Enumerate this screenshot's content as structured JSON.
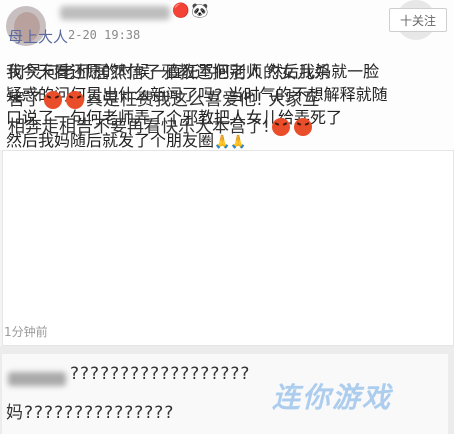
{
  "post": {
    "badges": "🔴🐼",
    "timestamp": "2-20 19:38",
    "follow_label": "十关注",
    "lines": [
      "我今天看还愿的时候一直狂骂何老师 然后我妈就一脸",
      "疑惑的问何炅出什么新闻了吗? 当时气的不想解释就随",
      "口说了一句何老师弄了个邪教把人女儿给弄死了",
      "然后我妈随后就发了个朋友圈"
    ],
    "line4_emoji": "🙏🙏"
  },
  "comment": {
    "username": "母上大人",
    "line1": "何炅何老师居然信了邪教还把别人的女儿杀",
    "line2_a": "害了",
    "line2_b": "真是枉费我这么喜爱他! 大家互",
    "line3": "相奔走相告不要再看快乐大本营了!",
    "time": "1分钟前"
  },
  "reply": {
    "line1": "??????????????????",
    "line2": "妈???????????????"
  },
  "watermark": "连你游戏"
}
